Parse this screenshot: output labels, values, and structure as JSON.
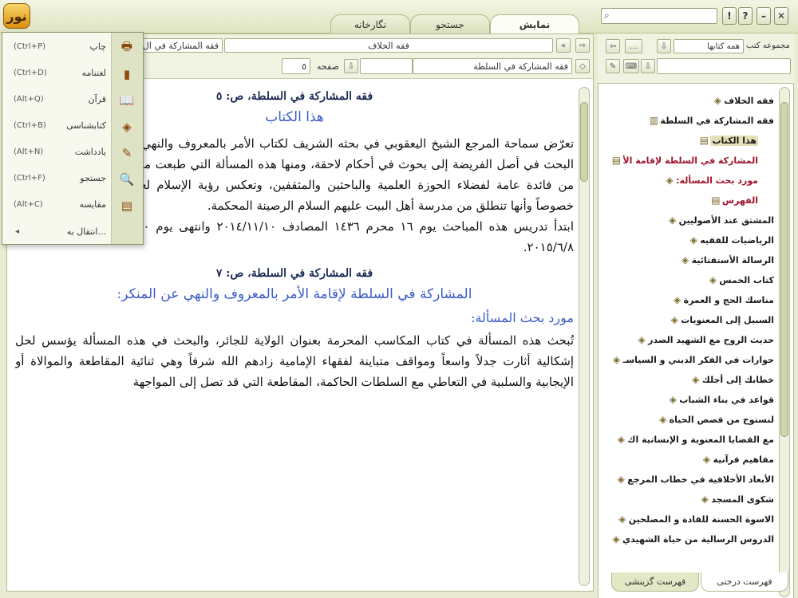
{
  "app": {
    "logo_text": "نور"
  },
  "tabs": [
    {
      "label": "نمایش",
      "active": true
    },
    {
      "label": "جستجو",
      "active": false
    },
    {
      "label": "نگارخانه",
      "active": false
    }
  ],
  "window_controls": {
    "help": "?",
    "info": "!",
    "minimize": "–",
    "close": "✕"
  },
  "content": {
    "book_tab_left": "فقه المشاركة في ال",
    "book_tab_mid": "فقه الخلاف",
    "page_label": "صفحه",
    "page_value": "٥",
    "location": "فقه المشاركة في السلطة",
    "page_heading_1": "فقه المشاركة في السلطة، ص: ٥",
    "section_title_1": "هذا الكتاب",
    "para_1": "تعرّض سماحة المرجع الشيخ اليعقوبي في بحثه الشريف لكتاب الأمر بالمعروف والنهي عن المنكر في أثنائه من البحث في أصل الفريضة إلى بحوث في أحكام لاحقة، ومنها هذه المسألة التي طبعت مستقلة عن الكتاب لما فيها من فائدة عامة لفضلاء الحوزة العلمية والباحثين والمثقفين، وتعكس رؤية الإسلام لعدد من القضايا السياسية خصوصاً وأنها تنطلق من مدرسة أهل البيت عليهم السلام الرصينة المحكمة.",
    "para_2": "ابتدأ تدريس هذه المباحث يوم ١٦ محرم ١٤٣٦ المصادف ٢٠١٤/١١/١٠ وانتهى يوم ٢٠ شعبان ١٤٣٦ المصادف ٢٠١٥/٦/٨.",
    "page_heading_2": "فقه المشاركة في السلطة، ص: ٧",
    "section_title_2": "المشاركة في السلطة لإقامة الأمر بالمعروف والنهي عن المنكر:",
    "section_sub": "مورد بحث المسألة:",
    "para_3": "تُبحث هذه المسألة في كتاب المكاسب المحرمة بعنوان الولاية للجائر، والبحث في هذه المسألة يؤسس لحل إشكالية أثارت جدلاً واسعاً ومواقف متباينة لفقهاء الإمامية زادهم الله شرفاً وهي ثنائية المقاطعة والموالاة أو الإيجابية والسلبية في التعاطي مع السلطات الحاكمة، المقاطعة التي قد تصل إلى المواجهة"
  },
  "menu": {
    "items": [
      {
        "label": "چاپ",
        "shortcut": "(Ctrl+P)",
        "icon": "print-icon",
        "glyph": "🖶"
      },
      {
        "label": "لغتنامه",
        "shortcut": "(Ctrl+D)",
        "icon": "dictionary-icon",
        "glyph": "▮"
      },
      {
        "label": "قرآن",
        "shortcut": "(Alt+Q)",
        "icon": "quran-icon",
        "glyph": "📖"
      },
      {
        "label": "کتابشناسی",
        "shortcut": "(Ctrl+B)",
        "icon": "bibliography-icon",
        "glyph": "◈"
      },
      {
        "label": "یادداشت",
        "shortcut": "(Alt+N)",
        "icon": "note-icon",
        "glyph": "✎"
      },
      {
        "label": "جستجو",
        "shortcut": "(Ctrl+F)",
        "icon": "search-icon",
        "glyph": "🔍"
      },
      {
        "label": "مقایسه",
        "shortcut": "(Alt+C)",
        "icon": "compare-icon",
        "glyph": "▤"
      }
    ],
    "goto_label": "انتقال به..."
  },
  "tree_pane": {
    "collection_label": "مجموعه کتب",
    "collection_value": "همه کتابها",
    "items": [
      {
        "label": "فقه الخلاف",
        "style": "normal"
      },
      {
        "label": "فقه المشاركة في السلطة",
        "style": "normal"
      },
      {
        "label": "هذا الكتاب",
        "style": "selected"
      },
      {
        "label": "المشاركة في السلطة لإقامة الأ",
        "style": "red"
      },
      {
        "label": "مورد بحث المسألة:",
        "style": "red"
      },
      {
        "label": "الفهرس",
        "style": "red"
      },
      {
        "label": "المشتق عند الأصوليين",
        "style": "normal"
      },
      {
        "label": "الرياضيات للفقيه",
        "style": "normal"
      },
      {
        "label": "الرسالة الأستفتائية",
        "style": "normal"
      },
      {
        "label": "كتاب الخمس",
        "style": "normal"
      },
      {
        "label": "مناسك الحج و العمرة",
        "style": "normal"
      },
      {
        "label": "السبيل إلى المعنويات",
        "style": "normal"
      },
      {
        "label": "حديث الروح مع الشهيد الصدر",
        "style": "normal"
      },
      {
        "label": "حوارات في الفكر الديني و السياسـ",
        "style": "normal"
      },
      {
        "label": "خطابك إلى أجلك",
        "style": "normal"
      },
      {
        "label": "قواعد في بناء الشباب",
        "style": "normal"
      },
      {
        "label": "لنستوح من قصص الحياة",
        "style": "normal"
      },
      {
        "label": "مع القضايا المعنوية و الإنسانية اك",
        "style": "normal"
      },
      {
        "label": "مفاهيم قرآنية",
        "style": "normal"
      },
      {
        "label": "الأبعاد الأخلاقية في خطاب المرجع",
        "style": "normal"
      },
      {
        "label": "شكوى المسجد",
        "style": "normal"
      },
      {
        "label": "الاسوة الحسنة للقادة و المصلحين",
        "style": "normal"
      },
      {
        "label": "الدروس الرسالية من حياة الشهيدي",
        "style": "normal"
      }
    ],
    "bottom_tabs": [
      {
        "label": "فهرست درختی",
        "active": true
      },
      {
        "label": "فهرست گزینشی",
        "active": false
      }
    ]
  }
}
